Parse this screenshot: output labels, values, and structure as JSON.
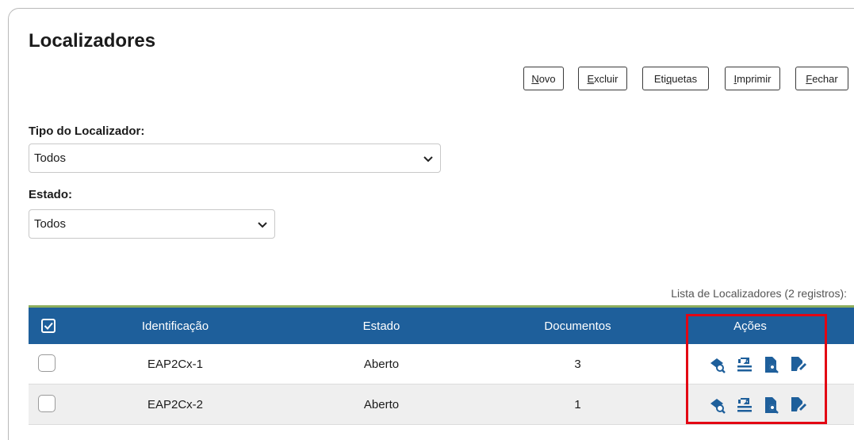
{
  "page": {
    "title": "Localizadores"
  },
  "toolbar": {
    "novo": {
      "accel": "N",
      "rest": "ovo"
    },
    "excluir": {
      "accel": "E",
      "rest": "xcluir"
    },
    "etiquetas": {
      "before": "Eti",
      "accel": "q",
      "after": "uetas"
    },
    "imprimir": {
      "accel": "I",
      "rest": "mprimir"
    },
    "fechar": {
      "accel": "F",
      "rest": "echar"
    }
  },
  "filters": {
    "tipo": {
      "label": "Tipo do Localizador:",
      "value": "Todos"
    },
    "estado": {
      "label": "Estado:",
      "value": "Todos"
    }
  },
  "list": {
    "caption": "Lista de Localizadores (2 registros):",
    "columns": {
      "identificacao": "Identificação",
      "estado": "Estado",
      "documentos": "Documentos",
      "acoes": "Ações"
    },
    "rows": [
      {
        "identificacao": "EAP2Cx-1",
        "estado": "Aberto",
        "documentos": "3"
      },
      {
        "identificacao": "EAP2Cx-2",
        "estado": "Aberto",
        "documentos": "1"
      }
    ],
    "action_icons": [
      "search-locator-icon",
      "transfer-icon",
      "document-search-icon",
      "edit-icon"
    ]
  },
  "colors": {
    "header_bg": "#1e5f9b",
    "header_accent": "#8fae5d",
    "icon": "#1e5f9b",
    "highlight": "#e30613"
  }
}
